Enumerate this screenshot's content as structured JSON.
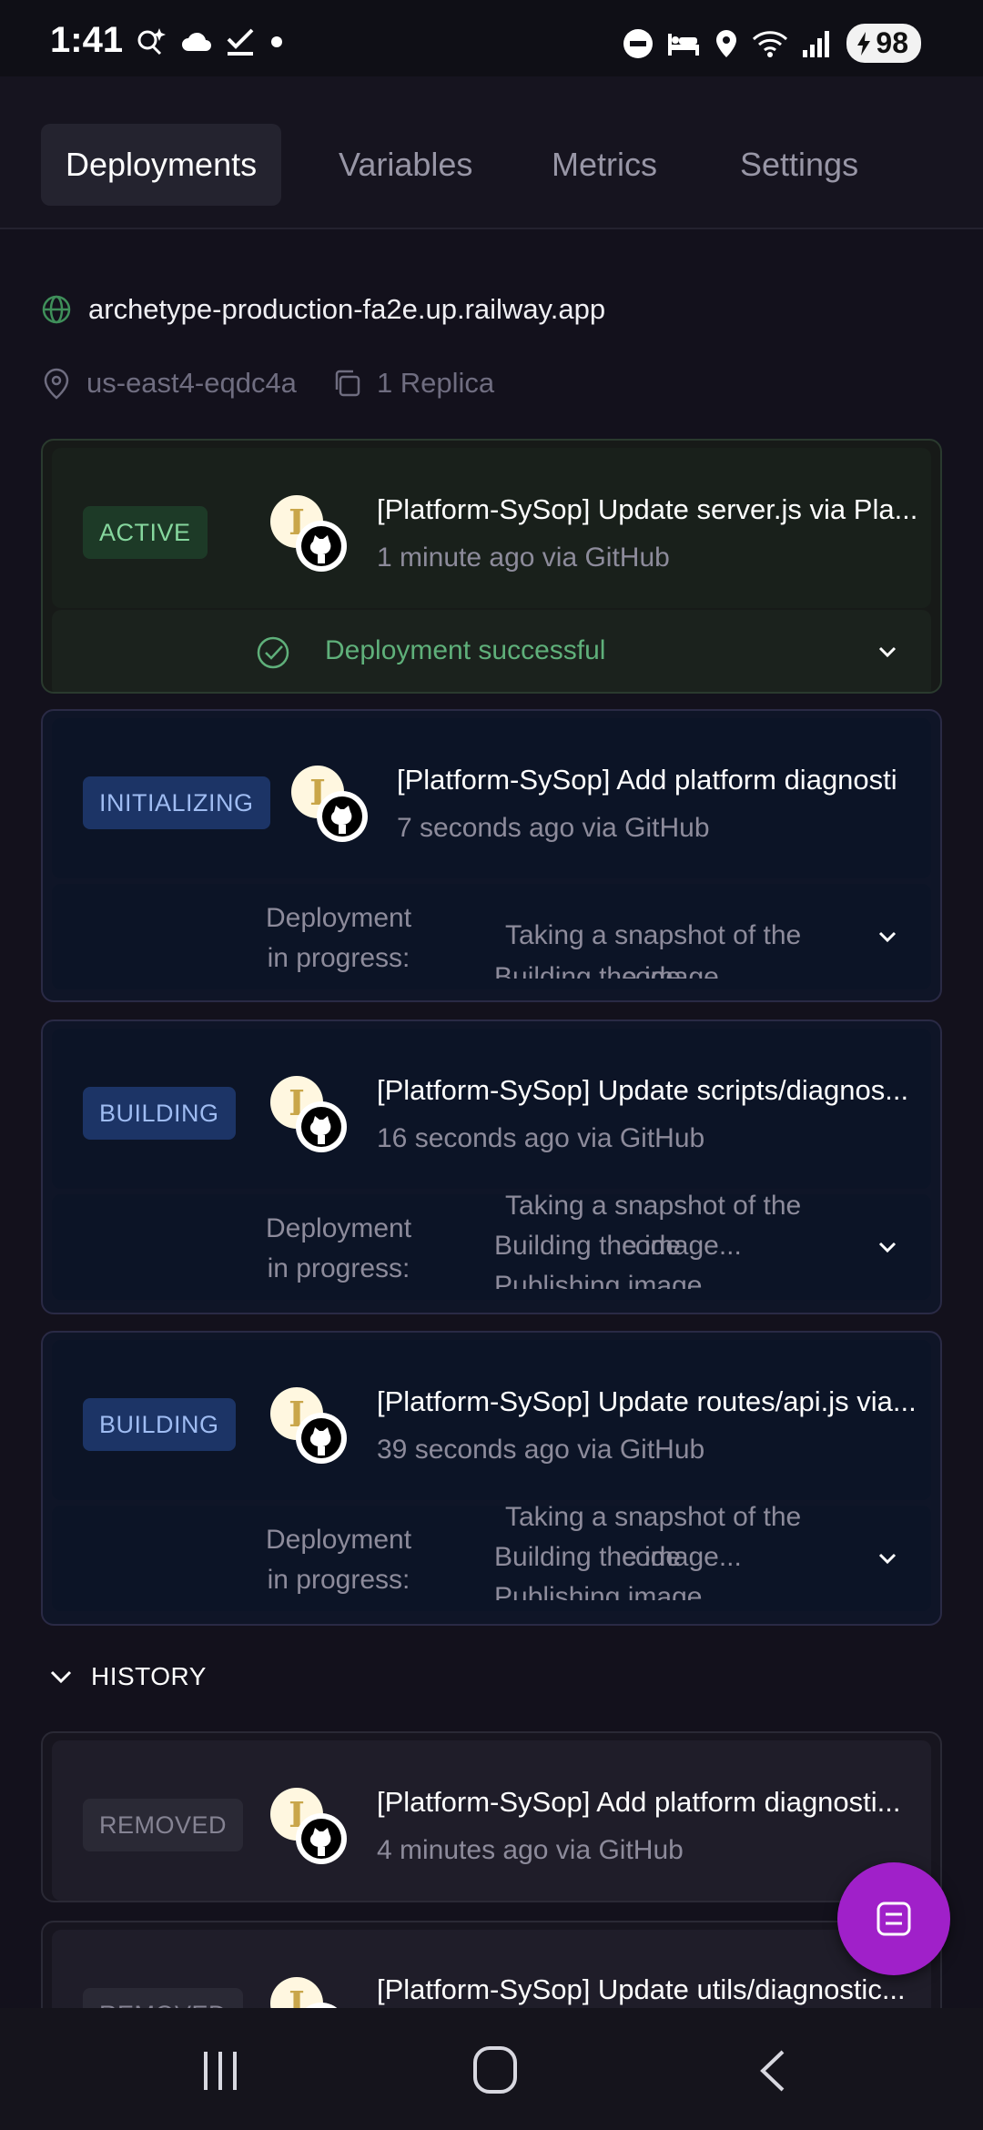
{
  "status_bar": {
    "time": "1:41",
    "battery": "98"
  },
  "tabs": [
    {
      "label": "Deployments",
      "active": true
    },
    {
      "label": "Variables",
      "active": false
    },
    {
      "label": "Metrics",
      "active": false
    },
    {
      "label": "Settings",
      "active": false
    }
  ],
  "service": {
    "domain": "archetype-production-fa2e.up.railway.app",
    "region": "us-east4-eqdc4a",
    "replicas": "1 Replica"
  },
  "deployments": [
    {
      "status": "ACTIVE",
      "title": "[Platform-SySop] Update server.js via Pla...",
      "time": "1 minute ago via GitHub",
      "footer": "Deployment successful"
    },
    {
      "status": "INITIALIZING",
      "title": "[Platform-SySop] Add platform diagnosti",
      "time": "7 seconds ago via GitHub",
      "footer_label": "Deployment in progress:",
      "steps": [
        "Taking a snapshot of the",
        "Building the image...",
        "code"
      ]
    },
    {
      "status": "BUILDING",
      "title": "[Platform-SySop] Update scripts/diagnos...",
      "time": "16 seconds ago via GitHub",
      "footer_label": "Deployment in progress:",
      "steps": [
        "Taking a snapshot of the",
        "Building the image...",
        "code",
        "Publishing image"
      ]
    },
    {
      "status": "BUILDING",
      "title": "[Platform-SySop] Update routes/api.js via...",
      "time": "39 seconds ago via GitHub",
      "footer_label": "Deployment in progress:",
      "steps": [
        "Taking a snapshot of the",
        "Building the image...",
        "code",
        "Publishing image"
      ]
    }
  ],
  "history": {
    "label": "HISTORY",
    "items": [
      {
        "status": "REMOVED",
        "title": "[Platform-SySop] Add platform diagnosti...",
        "time": "4 minutes ago via GitHub"
      },
      {
        "status": "REMOVED",
        "title": "[Platform-SySop] Update utils/diagnostic...",
        "time": ""
      }
    ]
  },
  "avatar_letter": "I",
  "colors": {
    "accent_fab": "#a020c9",
    "success": "#5fb07a",
    "building_badge": "#1c3466"
  }
}
